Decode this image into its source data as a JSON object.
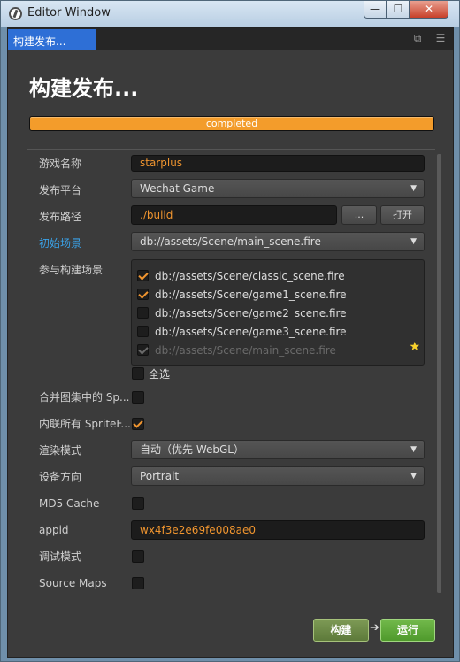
{
  "window": {
    "title": "Editor Window",
    "min": "—",
    "max": "☐",
    "close": "✕"
  },
  "tab": {
    "label": "构建发布..."
  },
  "page": {
    "title": "构建发布..."
  },
  "progress": {
    "text": "completed",
    "value": 1.0
  },
  "fields": {
    "game_name": {
      "label": "游戏名称",
      "value": "starplus"
    },
    "platform": {
      "label": "发布平台",
      "value": "Wechat Game"
    },
    "build_path": {
      "label": "发布路径",
      "value": "./build",
      "browse": "...",
      "open": "打开"
    },
    "start_scene": {
      "label": "初始场景",
      "value": "db://assets/Scene/main_scene.fire"
    },
    "scenes": {
      "label": "参与构建场景",
      "select_all": "全选"
    },
    "merge_atlas": {
      "label": "合并图集中的 Sp..."
    },
    "inline_sprite": {
      "label": "内联所有 SpriteF..."
    },
    "render_mode": {
      "label": "渲染模式",
      "value": "自动（优先 WebGL）"
    },
    "orientation": {
      "label": "设备方向",
      "value": "Portrait"
    },
    "md5": {
      "label": "MD5 Cache"
    },
    "appid": {
      "label": "appid",
      "value": "wx4f3e2e69fe008ae0"
    },
    "debug": {
      "label": "调试模式"
    },
    "source_maps": {
      "label": "Source Maps"
    }
  },
  "scene_list": [
    {
      "path": "db://assets/Scene/classic_scene.fire",
      "checked": true
    },
    {
      "path": "db://assets/Scene/game1_scene.fire",
      "checked": true
    },
    {
      "path": "db://assets/Scene/game2_scene.fire",
      "checked": false
    },
    {
      "path": "db://assets/Scene/game3_scene.fire",
      "checked": false
    },
    {
      "path": "db://assets/Scene/main_scene.fire",
      "checked": true,
      "disabled": true
    }
  ],
  "buttons": {
    "build": "构建",
    "arrow": "➔",
    "run": "运行"
  },
  "icons": {
    "arrow_down": "▼",
    "star": "★",
    "popout": "⧉",
    "menu": "☰"
  },
  "colors": {
    "accent": "#f39c2b",
    "tab_blue": "#2e6fd6",
    "link_blue": "#3aa2e8",
    "run_green": "#5fa83a"
  }
}
